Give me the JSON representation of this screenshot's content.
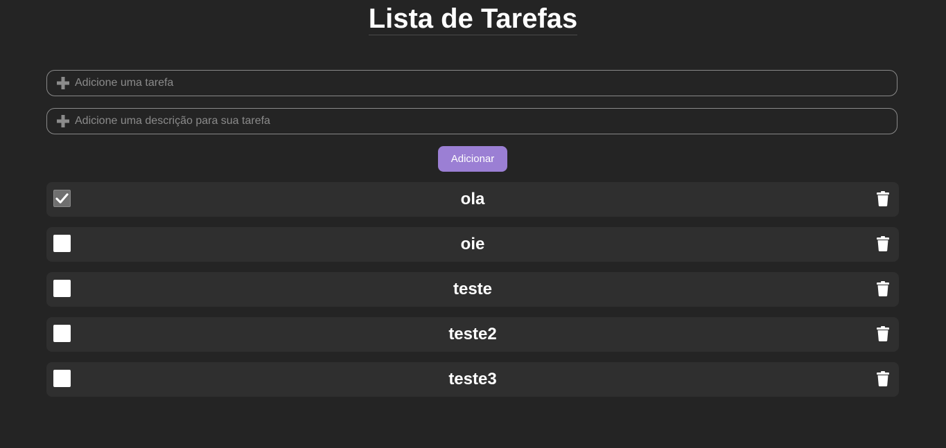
{
  "header": {
    "title": "Lista de Tarefas"
  },
  "form": {
    "task_placeholder": "Adicione uma tarefa",
    "task_value": "",
    "description_placeholder": "Adicione uma descrição para sua tarefa",
    "description_value": "",
    "add_label": "Adicionar",
    "input_icon": "plus-icon"
  },
  "tasks": [
    {
      "label": "ola",
      "checked": true
    },
    {
      "label": "oie",
      "checked": false
    },
    {
      "label": "teste",
      "checked": false
    },
    {
      "label": "teste2",
      "checked": false
    },
    {
      "label": "teste3",
      "checked": false
    }
  ],
  "colors": {
    "background": "#242424",
    "row_background": "#2f2f2f",
    "accent": "#9b7fd4",
    "text": "#ffffff",
    "placeholder": "#8b8b8b"
  },
  "icons": {
    "delete": "trash-icon",
    "check": "check-icon"
  }
}
